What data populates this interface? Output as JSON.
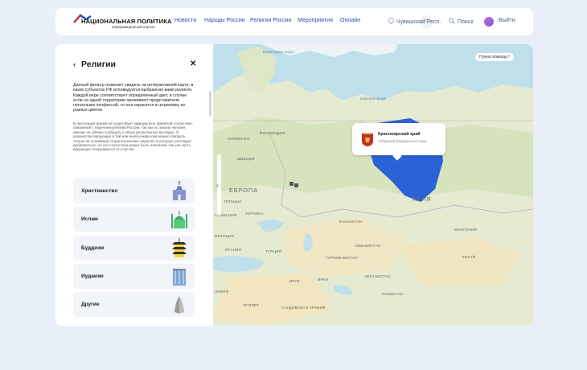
{
  "header": {
    "logo_title": "НАЦИОНАЛЬНАЯ ПОЛИТИКА",
    "logo_subtitle": "информационный портал",
    "nav": [
      "Новости",
      "Народы России",
      "Религии России",
      "Мероприятия",
      "Онлайн"
    ],
    "more": "···",
    "region": "Чувашская Респ.",
    "search": "Поиск",
    "logout": "Выйти"
  },
  "panel": {
    "title": "Религии",
    "back_icon": "chevron-left-icon",
    "close_icon": "close-icon",
    "description": "Данный фильтр позволит увидеть на интерактивной карте, в каких субъектах РФ исповедуется выбранная вами религия. Каждой вере соответствует определенный цвет, в случае если на одной территории проживают представители нескольких конфессий, то она окрасится в штриховку из разных цветов.",
    "note": "В настоящее время не существует официально принятой статистики, связанной с перечнем религий России, так как по закону человек никому не обязан сообщать о своих религиозных взглядах. О количестве верующих в той или иной конфессии можно говорить только на основании социологических опросов, в которых участвуют добровольно, но эта статистика может быть неполной, так как часть верующих отказывается от участия.",
    "religions": [
      {
        "label": "Христианство",
        "icon": "church-icon",
        "color": "#8a93c9"
      },
      {
        "label": "Ислам",
        "icon": "mosque-icon",
        "color": "#5bc97a"
      },
      {
        "label": "Буддизм",
        "icon": "pagoda-icon",
        "color": "#f2d53c"
      },
      {
        "label": "Иудаизм",
        "icon": "menorah-icon",
        "color": "#7ea4d6"
      },
      {
        "label": "Другие",
        "icon": "praying-hands-icon",
        "color": "#9a9a9a"
      }
    ]
  },
  "map": {
    "help": "Нужна помощь?",
    "popup": {
      "name": "Красноярский край",
      "district": "Сибирский федеральный округ"
    },
    "labels": {
      "barents": "Баренцево море",
      "kara": "Карское море",
      "europe": "ЕВРОПА",
      "asia": "АЗИЯ",
      "kazakhstan": "КАЗАХСТАН",
      "turkmenistan": "ТУРКМЕНИСТАН",
      "china": "КИТАЙ",
      "mongolia": "МОНГОЛИЯ",
      "ukraine": "УКРАИНА",
      "poland": "ПОЛЬША",
      "sweden": "ШВЕЦИЯ",
      "finland": "ФИНЛЯНДИЯ",
      "norway": "НОРВЕГИЯ",
      "germany": "ГЕРМАНИЯ",
      "france": "ФРАНЦИЯ",
      "italy": "ИТАЛИЯ",
      "turkey": "ТУРЦИЯ",
      "iran": "ИРАН",
      "iraq": "ИРАК",
      "afghanistan": "АФГАНИСТАН",
      "saudi": "САУДОВСКАЯ АРАВИЯ",
      "egypt": "ЕГИПЕТ",
      "libya": "ЛИВИЯ",
      "pakistan": "ПАКИСТАН",
      "uzbekistan": "УЗБЕКИСТАН"
    },
    "colors": {
      "highlight": "#2b63d6",
      "land": "#e6ead0",
      "water": "#bfe0ea"
    }
  }
}
